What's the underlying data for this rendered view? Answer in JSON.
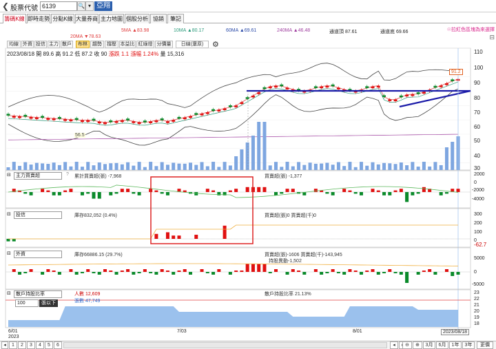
{
  "header": {
    "stock_label": "股票代號",
    "code": "6139",
    "name": "亞翔"
  },
  "tabs": [
    "籌碼K線",
    "即時走勢",
    "分點K線",
    "大量券商",
    "主力地圖",
    "個股分析",
    "協銷",
    "筆記"
  ],
  "note": "☉拉紅色區塊為來選擇",
  "ma": {
    "ma20": "20MA ▼78.63",
    "ma5": "5MA ▲83.98",
    "ma10": "10MA ▲80.17",
    "ma60": "60MA ▲69.61",
    "ma240": "240MA ▲46.48",
    "upper": "通道頂 87.61",
    "lower": "通道底 69.66"
  },
  "toolbar": [
    "均線",
    "外資",
    "投信",
    "主力",
    "散戶",
    "布林",
    "趨勢",
    "撐壓",
    "本益比",
    "紅綠燈",
    "分價量",
    "日線(還原)"
  ],
  "info": {
    "date": "2023/08/18",
    "open": "開 89.6",
    "high": "高 91.2",
    "low": "低 87.2",
    "close": "收 90",
    "change": "漲跌 1.1",
    "pct": "漲幅 1.24%",
    "vol": "量 15,316"
  },
  "price_axis": [
    "110",
    "100",
    "90",
    "80",
    "70",
    "60",
    "50",
    "40",
    "30"
  ],
  "price_marker": "91.2",
  "low_marker": "56.5",
  "panels": {
    "main": {
      "label": "主力買賣超",
      "legend1": "累計買賣超(張) -7,968",
      "legend2": "買賣超(張) -1,377",
      "axis": [
        "2000",
        "0",
        "-2000",
        "-4000"
      ]
    },
    "trust": {
      "label": "投信",
      "legend1": "庫存832,052 (0.4%)",
      "legend2": "買賣超(張)0 買賣超(千)0",
      "axis": [
        "300",
        "200",
        "100",
        "0"
      ],
      "marker": "-62.7"
    },
    "foreign": {
      "label": "外資",
      "legend1": "庫存66886.15 (29.7%)",
      "legend2": "買賣超(張)-1606 買賣超(千)-143,945",
      "legend3": "持股異動-1,502",
      "axis": [
        "5000",
        "0",
        "-5000"
      ]
    },
    "retail": {
      "label": "散戶持股比率",
      "legend1": "人數 12,609",
      "legend2": "張數 47,749",
      "legend3": "散戶持股比率 21.13%",
      "sel": "100",
      "sel_label": "張以下",
      "axis": [
        "23",
        "22",
        "21",
        "20",
        "19",
        "18"
      ]
    }
  },
  "xaxis": {
    "d1": "6/01",
    "y1": "2023",
    "d2": "7/03",
    "d3": "8/01",
    "dlast": "2023/08/18"
  },
  "bottom": {
    "pages": [
      "1",
      "2",
      "3",
      "4",
      "5",
      "6"
    ],
    "ranges": [
      "3月",
      "6月",
      "1年",
      "3年"
    ],
    "more": "更價"
  },
  "colors": {
    "up": "#e01010",
    "down": "#0a8a2a",
    "vol": "#7ea6e0",
    "channel": "#1a1aa8"
  }
}
